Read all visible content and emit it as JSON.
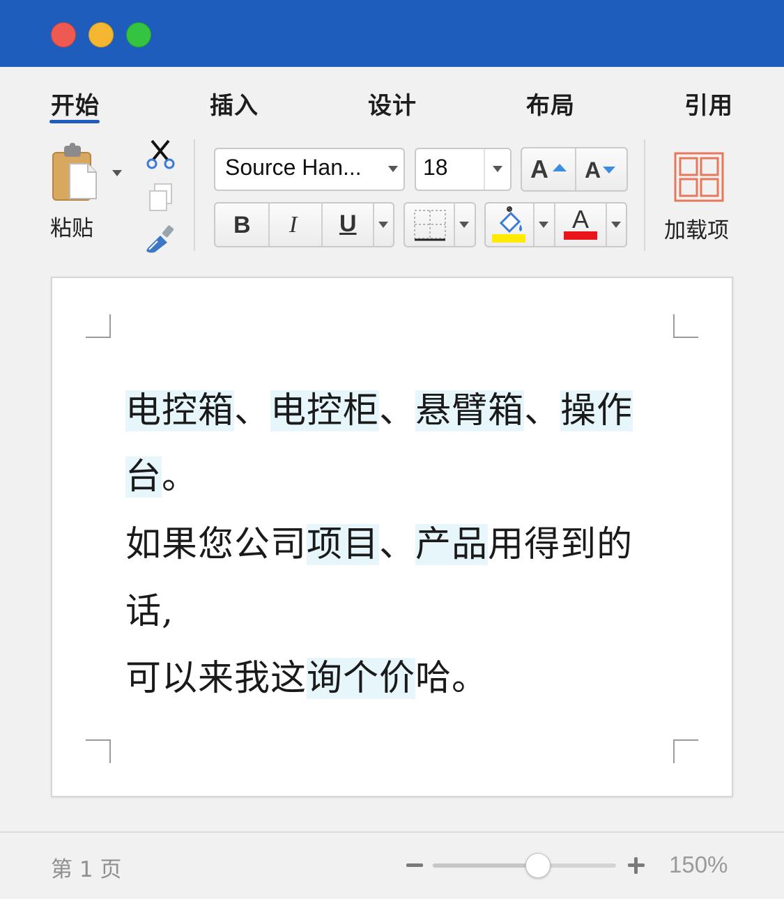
{
  "tabs": [
    {
      "label": "开始",
      "active": true
    },
    {
      "label": "插入"
    },
    {
      "label": "设计"
    },
    {
      "label": "布局"
    },
    {
      "label": "引用"
    }
  ],
  "clipboard": {
    "paste_label": "粘贴"
  },
  "font": {
    "name": "Source Han...",
    "size": "18"
  },
  "format": {
    "bold": "B",
    "italic": "I",
    "underline": "U",
    "grow": "A",
    "shrink": "A",
    "font_color_glyph": "A"
  },
  "colors": {
    "accent": "#1f5dbd",
    "highlight": "#ffea00",
    "font_color": "#e8161b"
  },
  "addins": {
    "label": "加载项"
  },
  "document": {
    "paragraphs": [
      [
        {
          "text": "电控箱",
          "hl": true
        },
        {
          "text": "、"
        },
        {
          "text": "电控柜",
          "hl": true
        },
        {
          "text": "、"
        },
        {
          "text": "悬臂箱",
          "hl": true
        },
        {
          "text": "、"
        },
        {
          "text": "操作",
          "hl": true
        }
      ],
      [
        {
          "text": "台",
          "hl": true
        },
        {
          "text": "。"
        }
      ],
      [
        {
          "text": "如果您公司"
        },
        {
          "text": "项目",
          "hl": true
        },
        {
          "text": "、"
        },
        {
          "text": "产品",
          "hl": true
        },
        {
          "text": "用得到的"
        }
      ],
      [
        {
          "text": "话,"
        }
      ],
      [
        {
          "text": "可以来我这"
        },
        {
          "text": "询个价",
          "hl": true
        },
        {
          "text": "哈。"
        }
      ]
    ]
  },
  "status": {
    "page": "第 1 页",
    "zoom": "150%",
    "zoom_level": 0.57
  }
}
